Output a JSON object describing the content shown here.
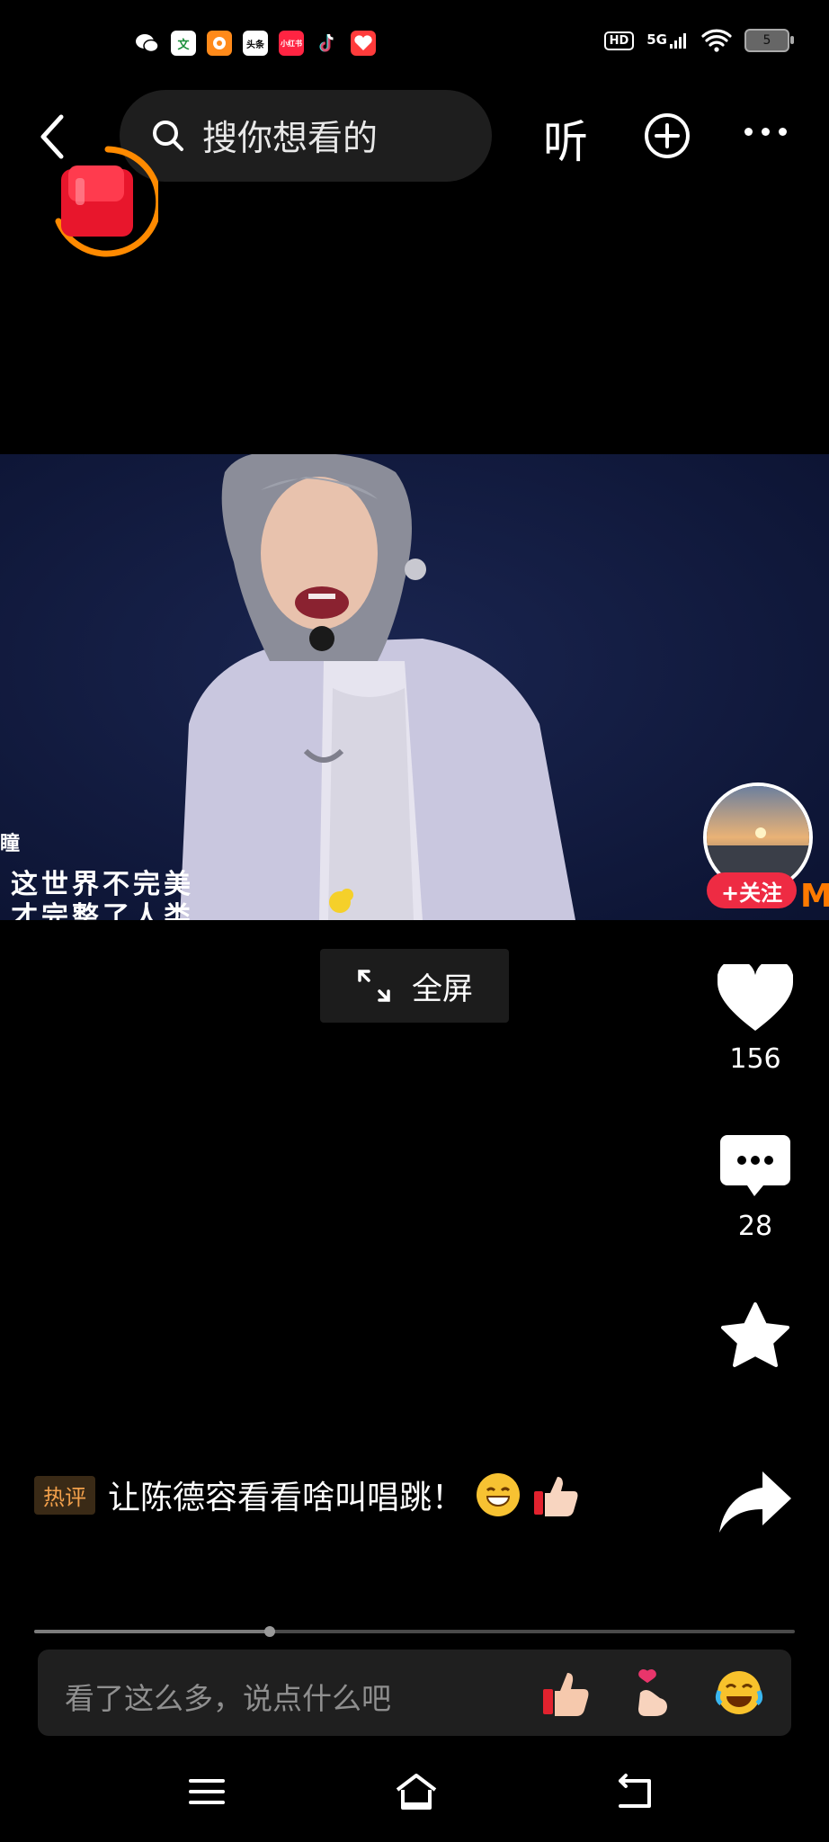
{
  "status_bar": {
    "apps": [
      "微信",
      "文",
      "相册",
      "头条",
      "小红书",
      "抖音",
      "阅读"
    ],
    "hd_label": "HD",
    "network": "5G",
    "battery": "5"
  },
  "top_bar": {
    "search_placeholder": "搜你想看的",
    "listen_label": "听"
  },
  "video": {
    "lyric_line_1": "这世界不完美",
    "lyric_line_2": "才完整了人类",
    "lyric_prefix": "瞳",
    "watermark": "M"
  },
  "author": {
    "follow_label": "+关注"
  },
  "fullscreen_label": "全屏",
  "actions": {
    "likes": "156",
    "comments": "28"
  },
  "hot_comment": {
    "tag": "热评",
    "text": "让陈德容看看啥叫唱跳！"
  },
  "playback": {
    "progress": 0.31
  },
  "comment_input": {
    "placeholder": "看了这么多，说点什么吧"
  },
  "colors": {
    "follow": "#ee2b43",
    "hot_tag": "#f2a04b",
    "background": "#000000"
  }
}
